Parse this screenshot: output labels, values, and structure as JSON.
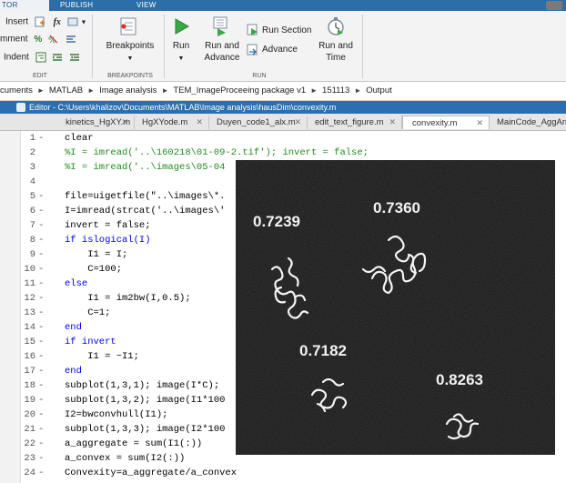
{
  "ribbon": {
    "tabs": [
      "TOR",
      "PUBLISH",
      "VIEW"
    ],
    "edit": {
      "insert_label": "Insert",
      "comment_label": "mment",
      "indent_label": "Indent",
      "section_label": "EDIT"
    },
    "breakpoints": {
      "button_label": "Breakpoints",
      "section_label": "BREAKPOINTS"
    },
    "run": {
      "run_label": "Run",
      "run_advance_label_1": "Run and",
      "run_advance_label_2": "Advance",
      "run_section_label": "Run Section",
      "advance_label": "Advance",
      "run_time_label_1": "Run and",
      "run_time_label_2": "Time",
      "section_label": "RUN"
    }
  },
  "address_bar": {
    "crumbs": [
      "cuments",
      "MATLAB",
      "Image analysis",
      "TEM_ImageProceeing package v1",
      "151113",
      "Output"
    ]
  },
  "editor": {
    "title": "Editor - C:\\Users\\khalizov\\Documents\\MATLAB\\Image analysis\\hausDim\\convexity.m",
    "tabs": [
      "kinetics_HgXY.m",
      "HgXYode.m",
      "Duyen_code1_alx.m",
      "edit_text_figure.m",
      "convexity.m",
      "MainCode_AggAn"
    ],
    "active_tab": "convexity.m",
    "lines": [
      {
        "n": "1",
        "code": "clear"
      },
      {
        "n": "2",
        "code": "%I = imread('..\\160218\\01-09-2.tif'); invert = false;"
      },
      {
        "n": "3",
        "code": "%I = imread('..\\images\\05-04"
      },
      {
        "n": "4",
        "code": ""
      },
      {
        "n": "5",
        "code": "file=uigetfile(\"..\\images\\*."
      },
      {
        "n": "6",
        "code": "I=imread(strcat('..\\images\\'"
      },
      {
        "n": "7",
        "code": "invert = false;"
      },
      {
        "n": "8",
        "code": "if islogical(I)"
      },
      {
        "n": "9",
        "code": "    I1 = I;"
      },
      {
        "n": "10",
        "code": "    C=100;"
      },
      {
        "n": "11",
        "code": "else"
      },
      {
        "n": "12",
        "code": "    I1 = im2bw(I,0.5);"
      },
      {
        "n": "13",
        "code": "    C=1;"
      },
      {
        "n": "14",
        "code": "end"
      },
      {
        "n": "15",
        "code": "if invert"
      },
      {
        "n": "16",
        "code": "    I1 = ~I1;"
      },
      {
        "n": "17",
        "code": "end"
      },
      {
        "n": "18",
        "code": "subplot(1,3,1); image(I*C);"
      },
      {
        "n": "19",
        "code": "subplot(1,3,2); image(I1*100"
      },
      {
        "n": "20",
        "code": "I2=bwconvhull(I1);"
      },
      {
        "n": "21",
        "code": "subplot(1,3,3); image(I2*100"
      },
      {
        "n": "22",
        "code": "a_aggregate = sum(I1(:))"
      },
      {
        "n": "23",
        "code": "a_convex = sum(I2(:))"
      },
      {
        "n": "24",
        "code": "Convexity=a_aggregate/a_convex"
      }
    ]
  },
  "overlay": {
    "labels": [
      "0.7239",
      "0.7360",
      "0.7182",
      "0.8263"
    ]
  }
}
